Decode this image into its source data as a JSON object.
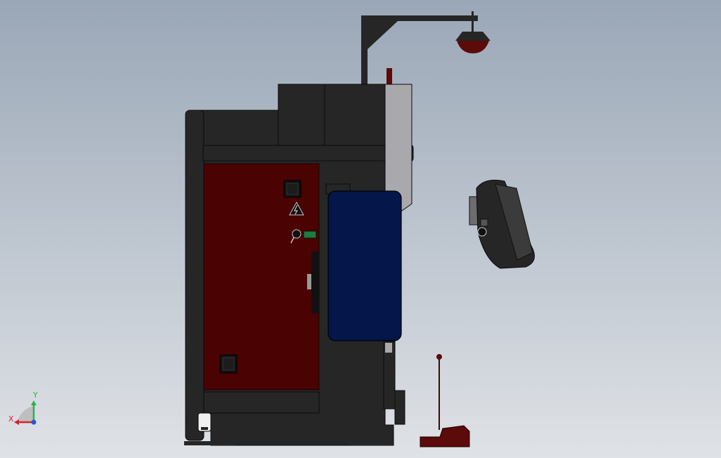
{
  "viewport": {
    "background_top": "#9aa7b7",
    "background_bottom": "#dfe2e6"
  },
  "colors": {
    "machine_body": "#262626",
    "machine_edge": "#0a0a0a",
    "cabinet_door": "#4a0202",
    "hydraulic_tank": "#04164a",
    "sheet_metal": "#a9a9ad",
    "accent_red": "#5c0a0a",
    "accent_green": "#1f7a3e"
  },
  "triad": {
    "x_label": "X",
    "y_label": "Y",
    "x_color": "#d0262a",
    "y_color": "#2bb24a",
    "z_color": "#2a56d6"
  },
  "icons": {
    "warning": "high-voltage-warning-icon",
    "key": "key-switch-icon"
  }
}
